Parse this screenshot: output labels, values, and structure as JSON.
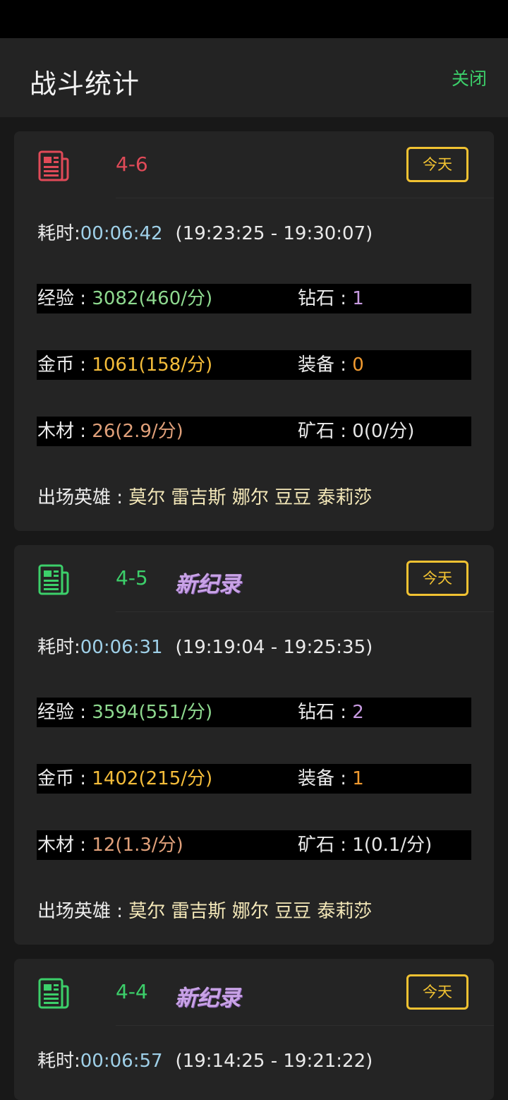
{
  "header": {
    "title": "战斗统计",
    "close_label": "关闭"
  },
  "labels": {
    "time": "耗时:",
    "exp": "经验 : ",
    "diamond": "钻石 : ",
    "gold": "金币 : ",
    "equip": "装备 : ",
    "wood": "木材 : ",
    "ore": "矿石 : ",
    "heroes": "出场英雄 : "
  },
  "colors": {
    "red": "#e04a58",
    "green": "#3ccf6a",
    "badge": "#f1c232",
    "record": "#c9a3e6"
  },
  "battles": [
    {
      "level": "4-6",
      "level_color": "#e04a58",
      "icon": "newspaper-icon",
      "record": "",
      "day": "今天",
      "duration": "00:06:42",
      "range": "(19:23:25 - 19:30:07)",
      "exp": "3082(460/分)",
      "diamond": "1",
      "gold": "1061(158/分)",
      "equip": "0",
      "wood": "26(2.9/分)",
      "ore": "0(0/分)",
      "heroes": "莫尔 雷吉斯 娜尔 豆豆 泰莉莎"
    },
    {
      "level": "4-5",
      "level_color": "#3ccf6a",
      "icon": "newspaper-icon",
      "record": "新纪录",
      "day": "今天",
      "duration": "00:06:31",
      "range": "(19:19:04 - 19:25:35)",
      "exp": "3594(551/分)",
      "diamond": "2",
      "gold": "1402(215/分)",
      "equip": "1",
      "wood": "12(1.3/分)",
      "ore": "1(0.1/分)",
      "heroes": "莫尔 雷吉斯 娜尔 豆豆 泰莉莎"
    },
    {
      "level": "4-4",
      "level_color": "#3ccf6a",
      "icon": "newspaper-icon",
      "record": "新纪录",
      "day": "今天",
      "duration": "00:06:57",
      "range": "(19:14:25 - 19:21:22)"
    }
  ]
}
